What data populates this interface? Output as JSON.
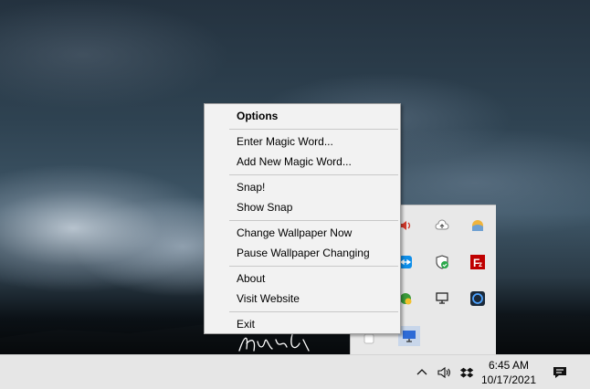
{
  "menu": {
    "title": "Options",
    "items": [
      {
        "label": "Enter Magic Word..."
      },
      {
        "label": "Add New Magic Word..."
      },
      {
        "label": "Snap!"
      },
      {
        "label": "Show Snap"
      },
      {
        "label": "Change Wallpaper Now"
      },
      {
        "label": "Pause Wallpaper Changing"
      },
      {
        "label": "About"
      },
      {
        "label": "Visit Website"
      },
      {
        "label": "Exit"
      }
    ]
  },
  "tray_flyout": {
    "icons": [
      "speaker-app-icon",
      "cloud-upload-icon",
      "weather-icon",
      "teamviewer-icon",
      "shield-check-icon",
      "filezilla-icon",
      "green-app-icon",
      "network-monitor-icon",
      "circle-app-icon",
      "white-square-icon",
      "monitor-icon"
    ]
  },
  "taskbar": {
    "time": "6:45 AM",
    "date": "10/17/2021",
    "icons": [
      "chevron-up-icon",
      "volume-icon",
      "dropbox-icon",
      "notification-icon"
    ]
  },
  "colors": {
    "menu_bg": "#f2f2f2",
    "taskbar_bg": "#e6e6e6",
    "filezilla_red": "#bf0000",
    "teamviewer_blue": "#0e8ee9",
    "shield_green": "#2aa84a"
  }
}
